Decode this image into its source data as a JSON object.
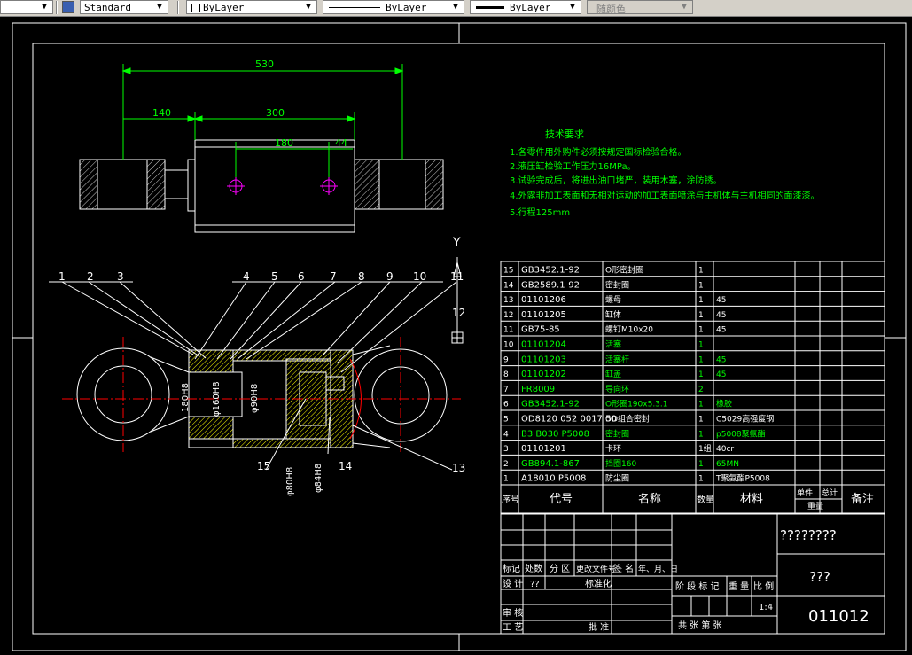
{
  "toolbar": {
    "text_style": "Standard",
    "color": "ByLayer",
    "linetype": "ByLayer",
    "lineweight": "ByLayer",
    "plot_style": "随颜色"
  },
  "dimensions": {
    "overall": "530",
    "left": "140",
    "body": "300",
    "ports": "180",
    "port_offset": "44",
    "d160": "φ160H8",
    "d180": "180H8",
    "d90": "φ90H8",
    "d80": "φ80H8",
    "d84": "φ84H8"
  },
  "balloons": [
    "1",
    "2",
    "3",
    "4",
    "5",
    "6",
    "7",
    "8",
    "9",
    "10",
    "11",
    "12",
    "13",
    "14",
    "15"
  ],
  "ucs": {
    "y": "Y"
  },
  "tech_requirements": {
    "title": "技术要求",
    "items": [
      "1.各零件用外购件必须按规定国标检验合格。",
      "2.液压缸检验工作压力16MPa。",
      "3.试验完成后，将进出油口堵严，装用木塞，涂防锈。",
      "4.外露非加工表面和无相对运动的加工表面喷涂与主机体与主机相同的面漆漆。",
      "5.行程125mm"
    ]
  },
  "parts_list": {
    "rows": [
      [
        "15",
        "GB3452.1-92",
        "O形密封圈",
        "1",
        "",
        ""
      ],
      [
        "14",
        "GB2589.1-92",
        "密封圈",
        "1",
        "",
        ""
      ],
      [
        "13",
        "01101206",
        "螺母",
        "1",
        "45",
        ""
      ],
      [
        "12",
        "01101205",
        "缸体",
        "1",
        "45",
        ""
      ],
      [
        "11",
        "GB75-85",
        "螺钉M10x20",
        "1",
        "45",
        ""
      ],
      [
        "10",
        "01101204",
        "活塞",
        "1",
        "",
        ""
      ],
      [
        "9",
        "01101203",
        "活塞杆",
        "1",
        "45",
        ""
      ],
      [
        "8",
        "01101202",
        "缸盖",
        "1",
        "45",
        ""
      ],
      [
        "7",
        "FR8009",
        "导向环",
        "2",
        "",
        ""
      ],
      [
        "6",
        "GB3452.1-92",
        "O形圈190x5.3.1",
        "1",
        "橡胶",
        ""
      ],
      [
        "5",
        "OD8120 052 0017 50",
        "OD组合密封",
        "1",
        "C5029高强度钢",
        ""
      ],
      [
        "4",
        "B3 B030 P5008",
        "密封圈",
        "1",
        "p5008聚氨酯",
        ""
      ],
      [
        "3",
        "01101201",
        "卡环",
        "1组",
        "40cr",
        ""
      ],
      [
        "2",
        "GB894.1-867",
        "挡圈160",
        "1",
        "65MN",
        ""
      ],
      [
        "1",
        "A18010 P5008",
        "防尘圈",
        "1",
        "T聚氨酯P5008",
        ""
      ]
    ],
    "header": {
      "seq": "序号",
      "code": "代号",
      "name": "名称",
      "qty": "数量",
      "material": "材料",
      "unit": "单件",
      "total": "总计",
      "weight": "重量",
      "remark": "备注"
    }
  },
  "title_block": {
    "drawing_title": "????????",
    "company": "???",
    "drawing_no": "011012",
    "mark": "标记",
    "count": "处数",
    "zone": "分 区",
    "doc_no": "更改文件号",
    "sign": "签 名",
    "date": "年、月、日",
    "design": "设 计",
    "designer": "??",
    "standardize": "标准化",
    "stage_mark": "阶 段 标 记",
    "weight": "重 量",
    "scale": "比 例",
    "scale_value": "1:4",
    "check": "审 核",
    "process": "工 艺",
    "approve": "批 准",
    "sheets": "共    张  第    张"
  },
  "colors": {
    "frame": "#ffffff",
    "dimension": "#00ff00",
    "section": "#ffff00",
    "center": "#ff0000",
    "green_text": "#00ff00",
    "magenta": "#ff00ff",
    "toolbar_bg": "#d4d0c8"
  }
}
